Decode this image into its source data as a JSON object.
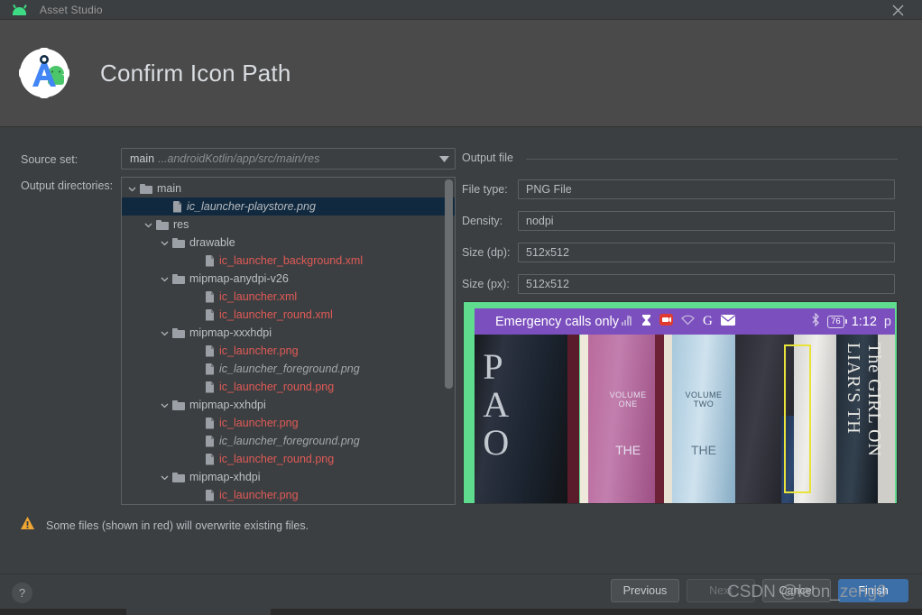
{
  "window": {
    "title": "Asset Studio",
    "app_icon": "android-icon",
    "close_icon": "close-icon"
  },
  "header": {
    "title": "Confirm Icon Path",
    "logo_icon": "android-studio-asset-icon"
  },
  "form": {
    "source_set_label": "Source set:",
    "source_set_value_main": "main",
    "source_set_value_path": "...androidKotlin/app/src/main/res",
    "dropdown_icon": "chevron-down-icon",
    "output_directories_label": "Output directories:"
  },
  "tree": [
    {
      "label": "main",
      "depth": 0,
      "type": "folder",
      "style": "normal",
      "expanded": true,
      "selected": false
    },
    {
      "label": "ic_launcher-playstore.png",
      "depth": 2,
      "type": "file",
      "style": "sel-it",
      "expanded": null,
      "selected": true
    },
    {
      "label": "res",
      "depth": 1,
      "type": "folder",
      "style": "normal",
      "expanded": true,
      "selected": false
    },
    {
      "label": "drawable",
      "depth": 2,
      "type": "folder",
      "style": "normal",
      "expanded": true,
      "selected": false
    },
    {
      "label": "ic_launcher_background.xml",
      "depth": 4,
      "type": "file",
      "style": "red",
      "expanded": null,
      "selected": false
    },
    {
      "label": "mipmap-anydpi-v26",
      "depth": 2,
      "type": "folder",
      "style": "normal",
      "expanded": true,
      "selected": false
    },
    {
      "label": "ic_launcher.xml",
      "depth": 4,
      "type": "file",
      "style": "red",
      "expanded": null,
      "selected": false
    },
    {
      "label": "ic_launcher_round.xml",
      "depth": 4,
      "type": "file",
      "style": "red",
      "expanded": null,
      "selected": false
    },
    {
      "label": "mipmap-xxxhdpi",
      "depth": 2,
      "type": "folder",
      "style": "normal",
      "expanded": true,
      "selected": false
    },
    {
      "label": "ic_launcher.png",
      "depth": 4,
      "type": "file",
      "style": "red",
      "expanded": null,
      "selected": false
    },
    {
      "label": "ic_launcher_foreground.png",
      "depth": 4,
      "type": "file",
      "style": "gray-it",
      "expanded": null,
      "selected": false
    },
    {
      "label": "ic_launcher_round.png",
      "depth": 4,
      "type": "file",
      "style": "red",
      "expanded": null,
      "selected": false
    },
    {
      "label": "mipmap-xxhdpi",
      "depth": 2,
      "type": "folder",
      "style": "normal",
      "expanded": true,
      "selected": false
    },
    {
      "label": "ic_launcher.png",
      "depth": 4,
      "type": "file",
      "style": "red",
      "expanded": null,
      "selected": false
    },
    {
      "label": "ic_launcher_foreground.png",
      "depth": 4,
      "type": "file",
      "style": "gray-it",
      "expanded": null,
      "selected": false
    },
    {
      "label": "ic_launcher_round.png",
      "depth": 4,
      "type": "file",
      "style": "red",
      "expanded": null,
      "selected": false
    },
    {
      "label": "mipmap-xhdpi",
      "depth": 2,
      "type": "folder",
      "style": "normal",
      "expanded": true,
      "selected": false
    },
    {
      "label": "ic_launcher.png",
      "depth": 4,
      "type": "file",
      "style": "red",
      "expanded": null,
      "selected": false
    }
  ],
  "output_file": {
    "group_label": "Output file",
    "rows": [
      {
        "label": "File type:",
        "value": "PNG File"
      },
      {
        "label": "Density:",
        "value": "nodpi"
      },
      {
        "label": "Size (dp):",
        "value": "512x512"
      },
      {
        "label": "Size (px):",
        "value": "512x512"
      }
    ]
  },
  "preview": {
    "status_text": "Emergency calls only",
    "battery_level": "76",
    "clock": "1:12",
    "clock_suffix": "p",
    "status_icons": [
      "signal-icon",
      "hourglass-icon",
      "screen-record-icon",
      "wifi-icon",
      "google-icon",
      "mail-icon",
      "bluetooth-icon",
      "battery-icon"
    ],
    "book_titles": [
      "PAO",
      "VOLUME ONE THE",
      "VOLUME TWO THE",
      "The GIRL ON LIAR'S TH"
    ],
    "border_color": "#5fdc8d",
    "statusbar_color": "#7b4fbe"
  },
  "warning": {
    "icon": "warning-triangle-icon",
    "text": "Some files (shown in red) will overwrite existing files."
  },
  "footer": {
    "help_label": "?",
    "buttons": [
      {
        "label": "Previous",
        "state": "enabled"
      },
      {
        "label": "Next",
        "state": "disabled"
      },
      {
        "label": "Cancel",
        "state": "enabled"
      },
      {
        "label": "Finish",
        "state": "primary"
      }
    ],
    "watermark": "CSDN @leon_zeng0"
  }
}
